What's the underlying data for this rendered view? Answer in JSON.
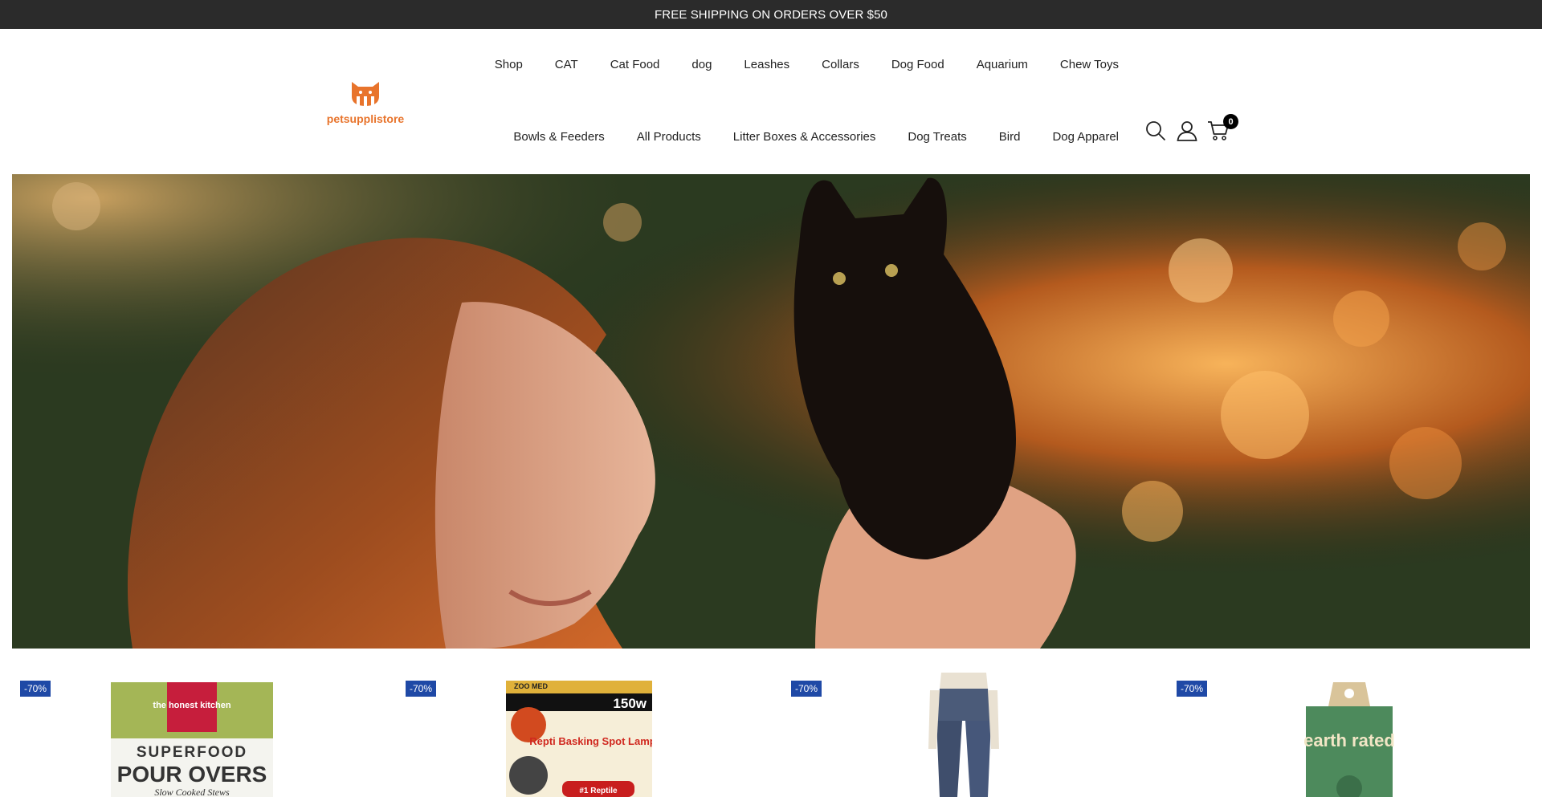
{
  "announcement": "FREE SHIPPING ON ORDERS OVER $50",
  "logo": {
    "text": "petsupplistore",
    "color": "#e8742c"
  },
  "nav": {
    "row1": [
      "Shop",
      "CAT",
      "Cat Food",
      "dog",
      "Leashes",
      "Collars",
      "Dog Food",
      "Aquarium",
      "Chew Toys"
    ],
    "row2": [
      "Bowls & Feeders",
      "All Products",
      "Litter Boxes & Accessories",
      "Dog Treats",
      "Bird",
      "Dog Apparel"
    ]
  },
  "header_icons": [
    "search-icon",
    "account-icon",
    "cart-icon"
  ],
  "cart": {
    "count": "0"
  },
  "products": [
    {
      "badge": "-70%",
      "brand": "the honest kitchen",
      "line1": "SUPERFOOD",
      "line2": "POUR OVERS",
      "line3": "Slow Cooked Stews"
    },
    {
      "badge": "-70%",
      "wattage": "150w",
      "brand": "ZOO MED",
      "title": "Repti Basking Spot Lamp",
      "tag": "#1 Reptile"
    },
    {
      "badge": "-70%"
    },
    {
      "badge": "-70%",
      "brand": "earth rated"
    }
  ],
  "colors": {
    "topbar": "#2b2b2b",
    "badge": "#1f49a6",
    "accent": "#e8742c"
  }
}
